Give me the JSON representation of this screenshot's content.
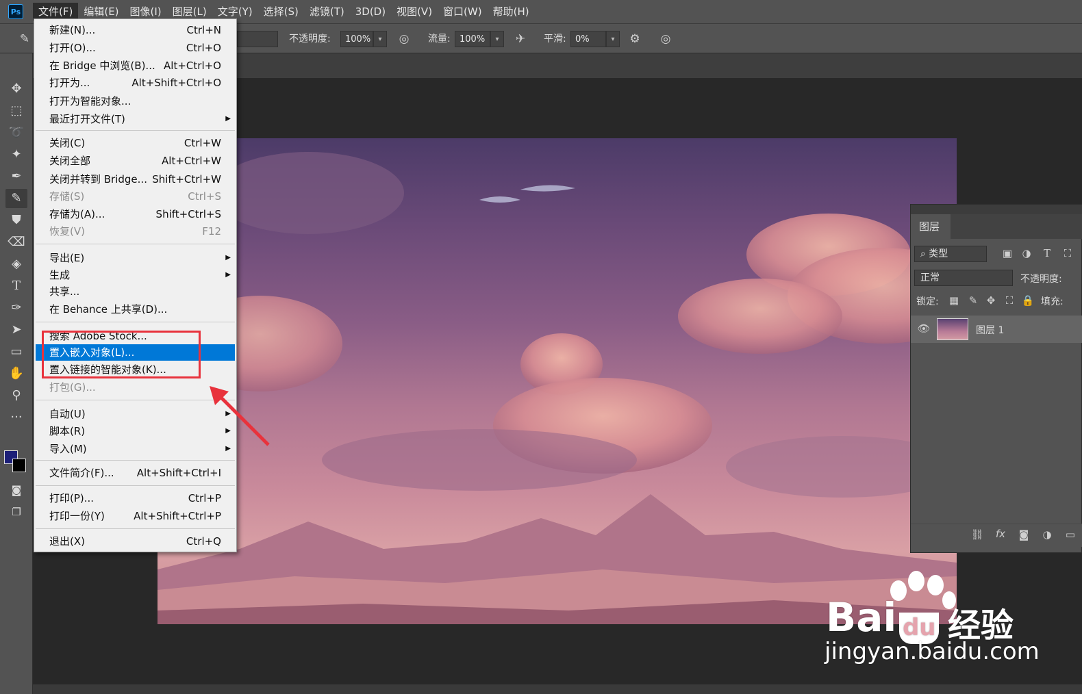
{
  "app": {
    "logo": "Ps"
  },
  "menubar": {
    "items": [
      "文件(F)",
      "编辑(E)",
      "图像(I)",
      "图层(L)",
      "文字(Y)",
      "选择(S)",
      "滤镜(T)",
      "3D(D)",
      "视图(V)",
      "窗口(W)",
      "帮助(H)"
    ],
    "active": "文件(F)"
  },
  "options": {
    "opacity_label": "不透明度:",
    "opacity_value": "100%",
    "flow_label": "流量:",
    "flow_value": "100%",
    "smooth_label": "平滑:",
    "smooth_value": "0%"
  },
  "file_menu": {
    "items": [
      {
        "label": "新建(N)...",
        "shortcut": "Ctrl+N"
      },
      {
        "label": "打开(O)...",
        "shortcut": "Ctrl+O"
      },
      {
        "label": "在 Bridge 中浏览(B)...",
        "shortcut": "Alt+Ctrl+O"
      },
      {
        "label": "打开为...",
        "shortcut": "Alt+Shift+Ctrl+O"
      },
      {
        "label": "打开为智能对象...",
        "shortcut": ""
      },
      {
        "label": "最近打开文件(T)",
        "shortcut": "",
        "submenu": true
      },
      {
        "label": "关闭(C)",
        "shortcut": "Ctrl+W"
      },
      {
        "label": "关闭全部",
        "shortcut": "Alt+Ctrl+W"
      },
      {
        "label": "关闭并转到 Bridge...",
        "shortcut": "Shift+Ctrl+W"
      },
      {
        "label": "存储(S)",
        "shortcut": "Ctrl+S",
        "disabled": true
      },
      {
        "label": "存储为(A)...",
        "shortcut": "Shift+Ctrl+S"
      },
      {
        "label": "恢复(V)",
        "shortcut": "F12",
        "disabled": true
      },
      {
        "label": "导出(E)",
        "shortcut": "",
        "submenu": true
      },
      {
        "label": "生成",
        "shortcut": "",
        "submenu": true
      },
      {
        "label": "共享...",
        "shortcut": ""
      },
      {
        "label": "在 Behance 上共享(D)...",
        "shortcut": ""
      },
      {
        "label": "搜索 Adobe Stock...",
        "shortcut": ""
      },
      {
        "label": "置入嵌入对象(L)...",
        "shortcut": "",
        "highlighted": true
      },
      {
        "label": "置入链接的智能对象(K)...",
        "shortcut": ""
      },
      {
        "label": "打包(G)...",
        "shortcut": "",
        "disabled": true
      },
      {
        "label": "自动(U)",
        "shortcut": "",
        "submenu": true
      },
      {
        "label": "脚本(R)",
        "shortcut": "",
        "submenu": true
      },
      {
        "label": "导入(M)",
        "shortcut": "",
        "submenu": true
      },
      {
        "label": "文件简介(F)...",
        "shortcut": "Alt+Shift+Ctrl+I"
      },
      {
        "label": "打印(P)...",
        "shortcut": "Ctrl+P"
      },
      {
        "label": "打印一份(Y)",
        "shortcut": "Alt+Shift+Ctrl+P"
      },
      {
        "label": "退出(X)",
        "shortcut": "Ctrl+Q"
      }
    ]
  },
  "layers_panel": {
    "tab": "图层",
    "filter_type": "类型",
    "blend_mode": "正常",
    "opacity_label": "不透明度:",
    "lock_label": "锁定:",
    "fill_label": "填充:",
    "layers": [
      {
        "name": "图层 1",
        "visible": true
      }
    ],
    "footer_fx": "fx"
  },
  "watermark": {
    "brand": "Bai",
    "brand2": "经验",
    "url": "jingyan.baidu.com"
  },
  "colors": {
    "highlight": "#0078d7",
    "annotation_red": "#e8323c",
    "foreground_swatch": "#1c1f78",
    "background_swatch": "#000000"
  }
}
